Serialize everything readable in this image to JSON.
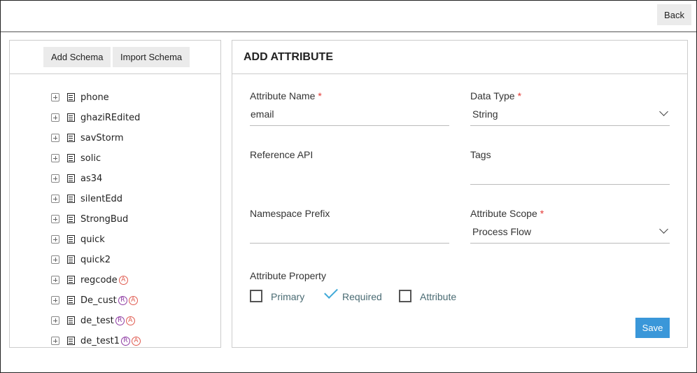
{
  "topbar": {
    "back_label": "Back"
  },
  "schema_panel": {
    "add_schema_label": "Add Schema",
    "import_schema_label": "Import Schema",
    "items": [
      {
        "name": "phone",
        "badges": []
      },
      {
        "name": "ghaziREdited",
        "badges": []
      },
      {
        "name": "savStorm",
        "badges": []
      },
      {
        "name": "solic",
        "badges": []
      },
      {
        "name": "as34",
        "badges": []
      },
      {
        "name": "silentEdd",
        "badges": []
      },
      {
        "name": "StrongBud",
        "badges": []
      },
      {
        "name": "quick",
        "badges": []
      },
      {
        "name": "quick2",
        "badges": []
      },
      {
        "name": "regcode",
        "badges": [
          "A"
        ]
      },
      {
        "name": "De_cust",
        "badges": [
          "R",
          "A"
        ]
      },
      {
        "name": "de_test",
        "badges": [
          "R",
          "A"
        ]
      },
      {
        "name": "de_test1",
        "badges": [
          "R",
          "A"
        ]
      }
    ]
  },
  "form": {
    "title": "ADD ATTRIBUTE",
    "attribute_name": {
      "label": "Attribute Name",
      "required_mark": "*",
      "value": "email"
    },
    "data_type": {
      "label": "Data Type",
      "required_mark": "*",
      "value": "String"
    },
    "reference_api": {
      "label": "Reference API"
    },
    "tags": {
      "label": "Tags",
      "value": ""
    },
    "namespace_prefix": {
      "label": "Namespace Prefix",
      "value": ""
    },
    "attribute_scope": {
      "label": "Attribute Scope",
      "required_mark": "*",
      "value": "Process Flow"
    },
    "attribute_property": {
      "label": "Attribute Property",
      "options": [
        {
          "label": "Primary",
          "checked": false
        },
        {
          "label": "Required",
          "checked": true
        },
        {
          "label": "Attribute",
          "checked": false
        }
      ]
    },
    "save_label": "Save"
  },
  "colors": {
    "accent": "#3a97d9",
    "check": "#3fa9d8",
    "required": "#e53935",
    "badge_r": "#8e3ba3",
    "badge_a": "#e05a4f"
  }
}
